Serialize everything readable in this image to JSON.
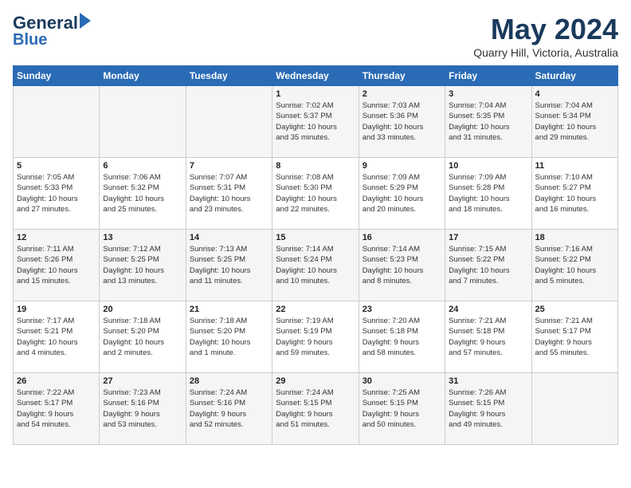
{
  "header": {
    "logo_line1": "General",
    "logo_line2": "Blue",
    "month_year": "May 2024",
    "location": "Quarry Hill, Victoria, Australia"
  },
  "weekdays": [
    "Sunday",
    "Monday",
    "Tuesday",
    "Wednesday",
    "Thursday",
    "Friday",
    "Saturday"
  ],
  "weeks": [
    [
      {
        "day": "",
        "info": ""
      },
      {
        "day": "",
        "info": ""
      },
      {
        "day": "",
        "info": ""
      },
      {
        "day": "1",
        "info": "Sunrise: 7:02 AM\nSunset: 5:37 PM\nDaylight: 10 hours\nand 35 minutes."
      },
      {
        "day": "2",
        "info": "Sunrise: 7:03 AM\nSunset: 5:36 PM\nDaylight: 10 hours\nand 33 minutes."
      },
      {
        "day": "3",
        "info": "Sunrise: 7:04 AM\nSunset: 5:35 PM\nDaylight: 10 hours\nand 31 minutes."
      },
      {
        "day": "4",
        "info": "Sunrise: 7:04 AM\nSunset: 5:34 PM\nDaylight: 10 hours\nand 29 minutes."
      }
    ],
    [
      {
        "day": "5",
        "info": "Sunrise: 7:05 AM\nSunset: 5:33 PM\nDaylight: 10 hours\nand 27 minutes."
      },
      {
        "day": "6",
        "info": "Sunrise: 7:06 AM\nSunset: 5:32 PM\nDaylight: 10 hours\nand 25 minutes."
      },
      {
        "day": "7",
        "info": "Sunrise: 7:07 AM\nSunset: 5:31 PM\nDaylight: 10 hours\nand 23 minutes."
      },
      {
        "day": "8",
        "info": "Sunrise: 7:08 AM\nSunset: 5:30 PM\nDaylight: 10 hours\nand 22 minutes."
      },
      {
        "day": "9",
        "info": "Sunrise: 7:09 AM\nSunset: 5:29 PM\nDaylight: 10 hours\nand 20 minutes."
      },
      {
        "day": "10",
        "info": "Sunrise: 7:09 AM\nSunset: 5:28 PM\nDaylight: 10 hours\nand 18 minutes."
      },
      {
        "day": "11",
        "info": "Sunrise: 7:10 AM\nSunset: 5:27 PM\nDaylight: 10 hours\nand 16 minutes."
      }
    ],
    [
      {
        "day": "12",
        "info": "Sunrise: 7:11 AM\nSunset: 5:26 PM\nDaylight: 10 hours\nand 15 minutes."
      },
      {
        "day": "13",
        "info": "Sunrise: 7:12 AM\nSunset: 5:25 PM\nDaylight: 10 hours\nand 13 minutes."
      },
      {
        "day": "14",
        "info": "Sunrise: 7:13 AM\nSunset: 5:25 PM\nDaylight: 10 hours\nand 11 minutes."
      },
      {
        "day": "15",
        "info": "Sunrise: 7:14 AM\nSunset: 5:24 PM\nDaylight: 10 hours\nand 10 minutes."
      },
      {
        "day": "16",
        "info": "Sunrise: 7:14 AM\nSunset: 5:23 PM\nDaylight: 10 hours\nand 8 minutes."
      },
      {
        "day": "17",
        "info": "Sunrise: 7:15 AM\nSunset: 5:22 PM\nDaylight: 10 hours\nand 7 minutes."
      },
      {
        "day": "18",
        "info": "Sunrise: 7:16 AM\nSunset: 5:22 PM\nDaylight: 10 hours\nand 5 minutes."
      }
    ],
    [
      {
        "day": "19",
        "info": "Sunrise: 7:17 AM\nSunset: 5:21 PM\nDaylight: 10 hours\nand 4 minutes."
      },
      {
        "day": "20",
        "info": "Sunrise: 7:18 AM\nSunset: 5:20 PM\nDaylight: 10 hours\nand 2 minutes."
      },
      {
        "day": "21",
        "info": "Sunrise: 7:18 AM\nSunset: 5:20 PM\nDaylight: 10 hours\nand 1 minute."
      },
      {
        "day": "22",
        "info": "Sunrise: 7:19 AM\nSunset: 5:19 PM\nDaylight: 9 hours\nand 59 minutes."
      },
      {
        "day": "23",
        "info": "Sunrise: 7:20 AM\nSunset: 5:18 PM\nDaylight: 9 hours\nand 58 minutes."
      },
      {
        "day": "24",
        "info": "Sunrise: 7:21 AM\nSunset: 5:18 PM\nDaylight: 9 hours\nand 57 minutes."
      },
      {
        "day": "25",
        "info": "Sunrise: 7:21 AM\nSunset: 5:17 PM\nDaylight: 9 hours\nand 55 minutes."
      }
    ],
    [
      {
        "day": "26",
        "info": "Sunrise: 7:22 AM\nSunset: 5:17 PM\nDaylight: 9 hours\nand 54 minutes."
      },
      {
        "day": "27",
        "info": "Sunrise: 7:23 AM\nSunset: 5:16 PM\nDaylight: 9 hours\nand 53 minutes."
      },
      {
        "day": "28",
        "info": "Sunrise: 7:24 AM\nSunset: 5:16 PM\nDaylight: 9 hours\nand 52 minutes."
      },
      {
        "day": "29",
        "info": "Sunrise: 7:24 AM\nSunset: 5:15 PM\nDaylight: 9 hours\nand 51 minutes."
      },
      {
        "day": "30",
        "info": "Sunrise: 7:25 AM\nSunset: 5:15 PM\nDaylight: 9 hours\nand 50 minutes."
      },
      {
        "day": "31",
        "info": "Sunrise: 7:26 AM\nSunset: 5:15 PM\nDaylight: 9 hours\nand 49 minutes."
      },
      {
        "day": "",
        "info": ""
      }
    ]
  ]
}
